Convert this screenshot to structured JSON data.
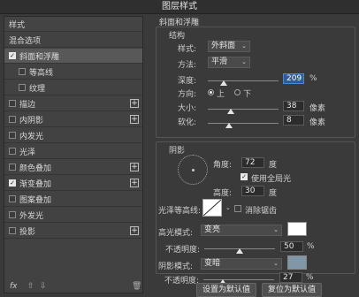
{
  "window": {
    "title": "图层样式"
  },
  "left_panel": {
    "header": "样式",
    "blend_options": "混合选项",
    "items": [
      {
        "label": "斜面和浮雕",
        "checked": true,
        "selected": true,
        "sub": false,
        "plus": false
      },
      {
        "label": "等高线",
        "checked": false,
        "selected": false,
        "sub": true,
        "plus": false
      },
      {
        "label": "纹理",
        "checked": false,
        "selected": false,
        "sub": true,
        "plus": false
      },
      {
        "label": "描边",
        "checked": false,
        "selected": false,
        "sub": false,
        "plus": true
      },
      {
        "label": "内阴影",
        "checked": false,
        "selected": false,
        "sub": false,
        "plus": true
      },
      {
        "label": "内发光",
        "checked": false,
        "selected": false,
        "sub": false,
        "plus": false
      },
      {
        "label": "光泽",
        "checked": false,
        "selected": false,
        "sub": false,
        "plus": false
      },
      {
        "label": "颜色叠加",
        "checked": false,
        "selected": false,
        "sub": false,
        "plus": true
      },
      {
        "label": "渐变叠加",
        "checked": true,
        "selected": false,
        "sub": false,
        "plus": true
      },
      {
        "label": "图案叠加",
        "checked": false,
        "selected": false,
        "sub": false,
        "plus": false
      },
      {
        "label": "外发光",
        "checked": false,
        "selected": false,
        "sub": false,
        "plus": false
      },
      {
        "label": "投影",
        "checked": false,
        "selected": false,
        "sub": false,
        "plus": true
      }
    ],
    "footer": {
      "fx": "fx",
      "up": "⇧",
      "down": "⇩",
      "trash": "🗑"
    }
  },
  "bevel": {
    "section_title": "斜面和浮雕",
    "structure_title": "结构",
    "style_label": "样式:",
    "style_value": "外斜面",
    "technique_label": "方法:",
    "technique_value": "平滑",
    "depth_label": "深度:",
    "depth_value": "209",
    "depth_unit": "%",
    "direction_label": "方向:",
    "dir_up": "上",
    "dir_down": "下",
    "direction": "up",
    "size_label": "大小:",
    "size_value": "38",
    "size_unit": "像素",
    "soften_label": "软化:",
    "soften_value": "8",
    "soften_unit": "像素",
    "sliders": {
      "depth": 0.22,
      "size": 0.32,
      "soften": 0.3
    }
  },
  "shading": {
    "section_title": "阴影",
    "angle_label": "角度:",
    "angle_value": "72",
    "angle_unit": "度",
    "global_light_label": "使用全局光",
    "global_light": true,
    "altitude_label": "高度:",
    "altitude_value": "30",
    "altitude_unit": "度",
    "gloss_label": "光泽等高线:",
    "antialias_label": "消除锯齿",
    "antialias": false,
    "highlight_mode_label": "高光模式:",
    "highlight_mode": "变亮",
    "highlight_color": "#ffffff",
    "highlight_opacity_label": "不透明度:",
    "highlight_opacity": "50",
    "highlight_opacity_unit": "%",
    "shadow_mode_label": "阴影模式:",
    "shadow_mode": "变暗",
    "shadow_color": "#7f97a7",
    "shadow_opacity_label": "不透明度:",
    "shadow_opacity": "27",
    "shadow_opacity_unit": "%",
    "sliders": {
      "highlight_opacity": 0.5,
      "shadow_opacity": 0.27
    }
  },
  "buttons": {
    "set_default": "设置为默认值",
    "reset_default": "复位为默认值"
  }
}
